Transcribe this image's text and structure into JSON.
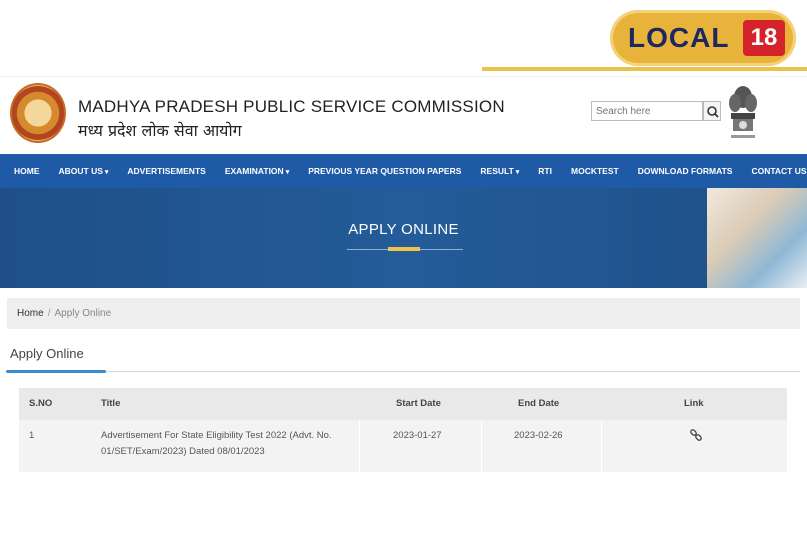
{
  "badge": {
    "brand": "LOCAL",
    "number": "18"
  },
  "header": {
    "org_english": "MADHYA PRADESH PUBLIC SERVICE COMMISSION",
    "org_hindi": "मध्य प्रदेश लोक सेवा आयोग",
    "search_placeholder": "Search here"
  },
  "nav": {
    "items": [
      {
        "label": "HOME",
        "dropdown": false
      },
      {
        "label": "ABOUT US",
        "dropdown": true
      },
      {
        "label": "ADVERTISEMENTS",
        "dropdown": false
      },
      {
        "label": "EXAMINATION",
        "dropdown": true
      },
      {
        "label": "PREVIOUS YEAR QUESTION PAPERS",
        "dropdown": false
      },
      {
        "label": "RESULT",
        "dropdown": true
      },
      {
        "label": "RTI",
        "dropdown": false
      },
      {
        "label": "MOCKTEST",
        "dropdown": false
      },
      {
        "label": "DOWNLOAD FORMATS",
        "dropdown": false
      },
      {
        "label": "CONTACT US",
        "dropdown": false
      }
    ]
  },
  "banner": {
    "title": "APPLY ONLINE"
  },
  "breadcrumb": {
    "home": "Home",
    "separator": "/",
    "current": "Apply Online"
  },
  "section": {
    "title": "Apply Online"
  },
  "table": {
    "headers": {
      "sno": "S.NO",
      "title": "Title",
      "start": "Start Date",
      "end": "End Date",
      "link": "Link"
    },
    "rows": [
      {
        "sno": "1",
        "title_line1": "Advertisement For State Eligibility Test 2022 (Advt. No.",
        "title_line2": "01/SET/Exam/2023) Dated 08/01/2023",
        "start": "2023-01-27",
        "end": "2023-02-26",
        "link_icon": "link-icon"
      }
    ]
  },
  "colors": {
    "nav_blue": "#1f5aa6",
    "banner_blue": "#235c99",
    "badge_gold": "#e8b33a",
    "badge_red": "#d4232b",
    "accent_blue": "#3a8dd0"
  }
}
